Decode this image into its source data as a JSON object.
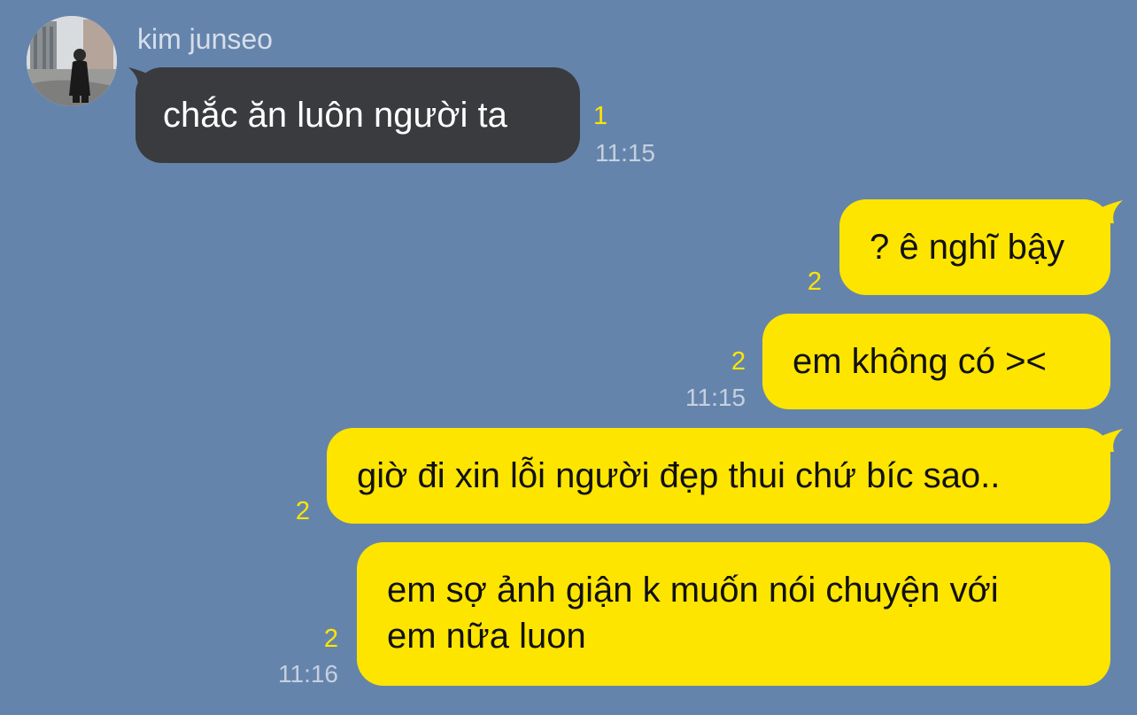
{
  "sender": {
    "name": "kim junseo",
    "avatar_icon": "profile-photo-person-icon"
  },
  "messages": [
    {
      "side": "in",
      "text": "chắc ăn luôn người ta",
      "unread": "1",
      "time": "11:15"
    },
    {
      "side": "out",
      "text": "? ê nghĩ bậy",
      "unread": "2",
      "time": ""
    },
    {
      "side": "out",
      "text": "em không có ><",
      "unread": "2",
      "time": "11:15"
    },
    {
      "side": "out",
      "text": "giờ đi xin lỗi người đẹp thui chứ bíc sao..",
      "unread": "2",
      "time": ""
    },
    {
      "side": "out",
      "lines": [
        "em sợ ảnh giận k muốn nói chuyện với",
        "em nữa luon"
      ],
      "unread": "2",
      "time": "11:16"
    }
  ],
  "colors": {
    "background": "#6584ac",
    "incoming_bubble": "#3a3b3e",
    "outgoing_bubble": "#fee500",
    "unread_count": "#fee500"
  }
}
